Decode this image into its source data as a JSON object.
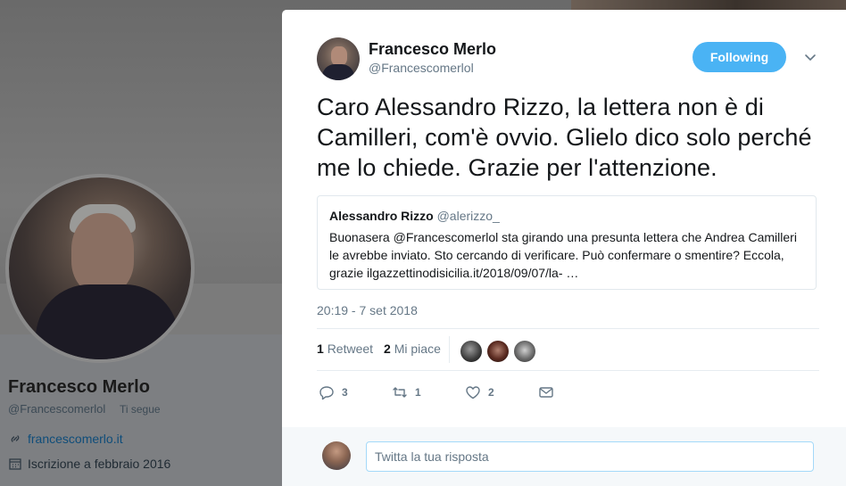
{
  "background_profile": {
    "name": "Francesco Merlo",
    "handle": "@Francescomerlol",
    "follows_you": "Ti segue",
    "website": "francescomerlo.it",
    "joined": "Iscrizione a febbraio 2016"
  },
  "tweet": {
    "author_name": "Francesco Merlo",
    "author_handle": "@Francescomerlol",
    "follow_button": "Following",
    "text": "Caro Alessandro Rizzo, la lettera  non è di Camilleri, com'è ovvio. Glielo dico solo perché me lo chiede. Grazie per l'attenzione.",
    "quoted": {
      "name": "Alessandro Rizzo",
      "handle": "@alerizzo_",
      "text": "Buonasera @Francescomerlol sta girando una presunta lettera che Andrea Camilleri le avrebbe inviato. Sto cercando di verificare. Può confermare o smentire? Eccola, grazie ilgazzettinodisicilia.it/2018/09/07/la-  …"
    },
    "timestamp": "20:19 - 7 set 2018",
    "stats": {
      "retweets_count": "1",
      "retweets_label": "Retweet",
      "likes_count": "2",
      "likes_label": "Mi piace"
    },
    "actions": {
      "reply_count": "3",
      "retweet_count": "1",
      "like_count": "2"
    },
    "reply_placeholder": "Twitta la tua risposta"
  },
  "colors": {
    "accent": "#4ab3f4",
    "link": "#1da1f2",
    "muted": "#657786",
    "text": "#14171a"
  }
}
